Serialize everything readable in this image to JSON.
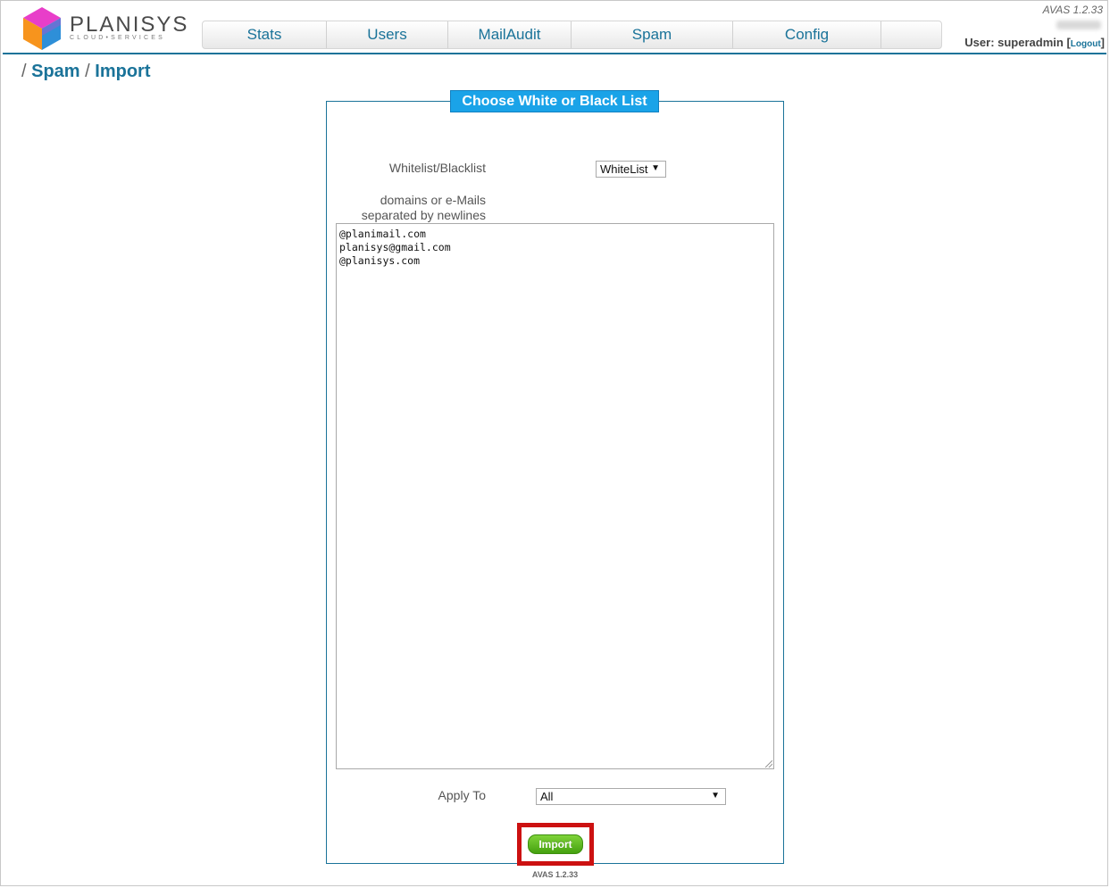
{
  "header": {
    "logo_text": "PLANISYS",
    "logo_sub": "CLOUD•SERVICES",
    "version": "AVAS 1.2.33",
    "user_label": "User: superadmin",
    "logout_label": "Logout"
  },
  "nav": {
    "items": [
      "Stats",
      "Users",
      "MailAudit",
      "Spam",
      "Config",
      ""
    ]
  },
  "breadcrumb": {
    "spam": "Spam",
    "import": "Import"
  },
  "form": {
    "legend": "Choose White or Black List",
    "list_label": "Whitelist/Blacklist",
    "list_value": "WhiteList",
    "entries_label_1": "domains or e-Mails",
    "entries_label_2": "separated by newlines",
    "entries": "@planimail.com\nplanisys@gmail.com\n@planisys.com",
    "apply_label": "Apply To",
    "apply_value": "All",
    "import_label": "Import"
  },
  "footer": {
    "version": "AVAS 1.2.33"
  },
  "colors": {
    "brand": "#1a7399",
    "legend_bg": "#1aa3e8",
    "import_green": "#5cb81f",
    "highlight_red": "#cc1111"
  }
}
